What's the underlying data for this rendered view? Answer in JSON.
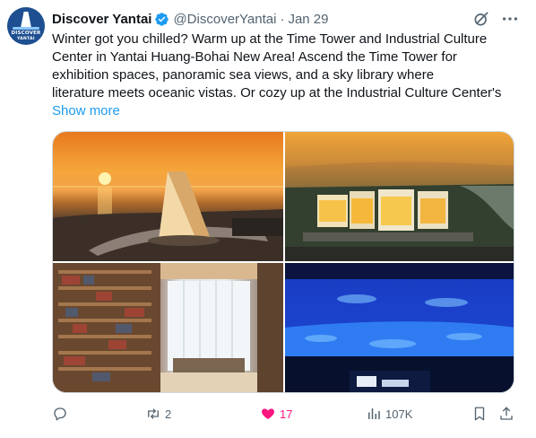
{
  "tweet": {
    "avatar_text_line1": "DISCOVER",
    "avatar_text_line2": "YANTAI",
    "display_name": "Discover Yantai",
    "handle": "@DiscoverYantai",
    "separator": "·",
    "date": "Jan 29",
    "text_lines": [
      "Winter got you chilled? Warm up at the Time Tower and Industrial Culture",
      "Center in Yantai Huang-Bohai New Area! Ascend the Time Tower for",
      "exhibition spaces, panoramic sea views, and a sky library where",
      "literature meets oceanic vistas. Or cozy up at the Industrial Culture Center's"
    ],
    "show_more": "Show more",
    "icons": {
      "verified": "verified-badge-icon",
      "grok": "grok-icon",
      "more": "more-options-icon"
    },
    "colors": {
      "accent": "#1d9bf0",
      "secondary_text": "#536471",
      "like_active": "#f91880"
    }
  },
  "media": [
    {
      "name": "time-tower-sunset-photo"
    },
    {
      "name": "industrial-culture-center-aerial-photo"
    },
    {
      "name": "sky-library-photo"
    },
    {
      "name": "immersive-ocean-exhibit-photo"
    }
  ],
  "actions": {
    "reply": {
      "icon": "reply-icon",
      "count": ""
    },
    "retweet": {
      "icon": "retweet-icon",
      "count": "2"
    },
    "like": {
      "icon": "heart-filled-icon",
      "count": "17"
    },
    "views": {
      "icon": "views-icon",
      "count": "107K"
    },
    "bookmark": {
      "icon": "bookmark-icon",
      "count": ""
    },
    "share": {
      "icon": "share-icon",
      "count": ""
    }
  }
}
